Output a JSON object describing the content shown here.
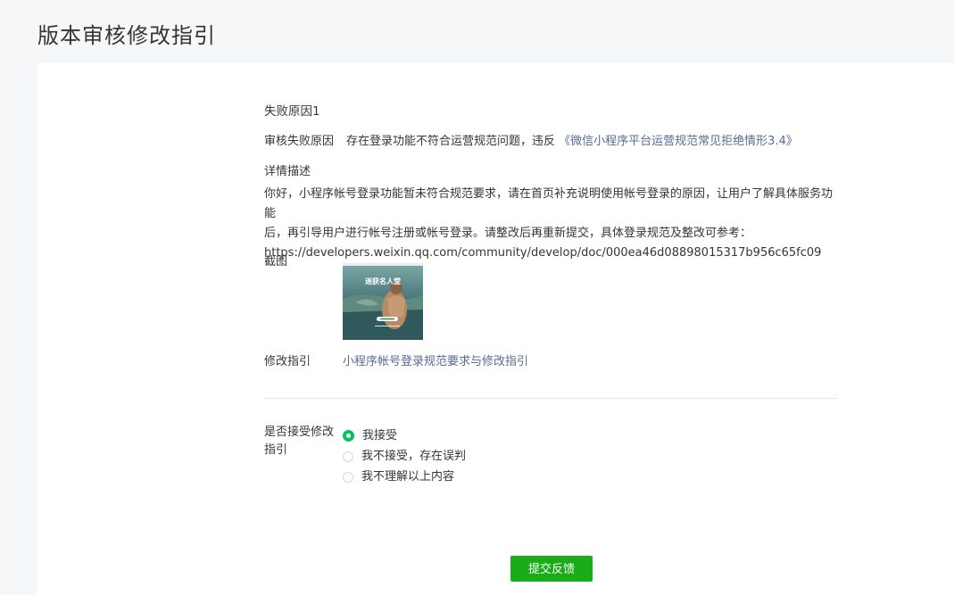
{
  "header": {
    "title": "版本审核修改指引"
  },
  "failure": {
    "title": "失败原因1",
    "reason_label": "审核失败原因",
    "reason_text": "存在登录功能不符合运营规范问题，违反",
    "reason_link": "《微信小程序平台运营规范常见拒绝情形3.4》",
    "detail_label": "详情描述",
    "detail_line1": "你好，小程序帐号登录功能暂未符合规范要求，请在首页补充说明使用帐号登录的原因，让用户了解具体服务功能",
    "detail_line2": "后，再引导用户进行帐号注册或帐号登录。请整改后再重新提交，具体登录规范及整改可参考：",
    "detail_line3": "https://developers.weixin.qq.com/community/develop/doc/000ea46d08898015317b956c65fc09",
    "screenshot_label": "截图",
    "screenshot_caption": "迷获名人堂",
    "guide_label": "修改指引",
    "guide_link": "小程序帐号登录规范要求与修改指引"
  },
  "accept": {
    "label": "是否接受修改指引",
    "options": [
      {
        "label": "我接受",
        "checked": true
      },
      {
        "label": "我不接受，存在误判",
        "checked": false
      },
      {
        "label": "我不理解以上内容",
        "checked": false
      }
    ]
  },
  "actions": {
    "submit_label": "提交反馈"
  },
  "colors": {
    "accent": "#07c160",
    "button": "#1aad19",
    "link": "#576b95"
  }
}
